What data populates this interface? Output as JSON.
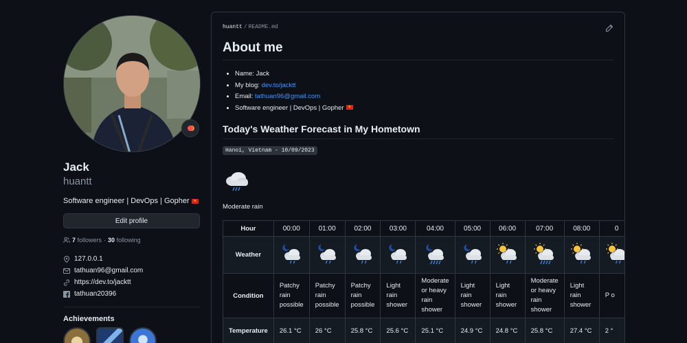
{
  "profile": {
    "name": "Jack",
    "login": "huantt",
    "bio": "Software engineer | DevOps | Gopher",
    "edit_label": "Edit profile",
    "followers_count": "7",
    "followers_label": "followers",
    "separator": "·",
    "following_count": "30",
    "following_label": "following",
    "location": "127.0.0.1",
    "email": "tathuan96@gmail.com",
    "website": "https://dev.to/jacktt",
    "facebook": "tathuan20396",
    "achievements_title": "Achievements"
  },
  "readme": {
    "crumb_user": "huantt",
    "crumb_sep": "/",
    "crumb_file": "README.md",
    "about_title": "About me",
    "name_line": "Name: Jack",
    "blog_prefix": "My blog: ",
    "blog_link": "dev.to/jacktt",
    "email_prefix": "Email: ",
    "email_link": "tathuan96@gmail.com",
    "bio_line": "Software engineer | DevOps | Gopher",
    "forecast_title": "Today's Weather Forecast in My Hometown",
    "location_date": "Hanoi, Vietnam - 10/09/2023",
    "current_condition": "Moderate rain"
  },
  "table": {
    "hour_label": "Hour",
    "weather_label": "Weather",
    "condition_label": "Condition",
    "temperature_label": "Temperature",
    "hours": [
      "00:00",
      "01:00",
      "02:00",
      "03:00",
      "04:00",
      "05:00",
      "06:00",
      "07:00",
      "08:00",
      "0"
    ],
    "icons": [
      "night-rain-icon",
      "night-rain-icon",
      "night-rain-icon",
      "night-shower-icon",
      "night-heavy-rain-icon",
      "night-shower-icon",
      "day-shower-icon",
      "day-heavy-rain-icon",
      "day-shower-icon",
      "day-shower-icon"
    ],
    "conditions": [
      "Patchy rain possible",
      "Patchy rain possible",
      "Patchy rain possible",
      "Light rain shower",
      "Moderate or heavy rain shower",
      "Light rain shower",
      "Light rain shower",
      "Moderate or heavy rain shower",
      "Light rain shower",
      "P o"
    ],
    "temperatures": [
      "26.1 °C",
      "26 °C",
      "25.8 °C",
      "25.6 °C",
      "25.1 °C",
      "24.9 °C",
      "24.8 °C",
      "25.8 °C",
      "27.4 °C",
      "2 °"
    ]
  },
  "colors": {
    "background": "#0d1117",
    "border": "#30363d",
    "link": "#4493f8",
    "muted": "#8b949e"
  }
}
